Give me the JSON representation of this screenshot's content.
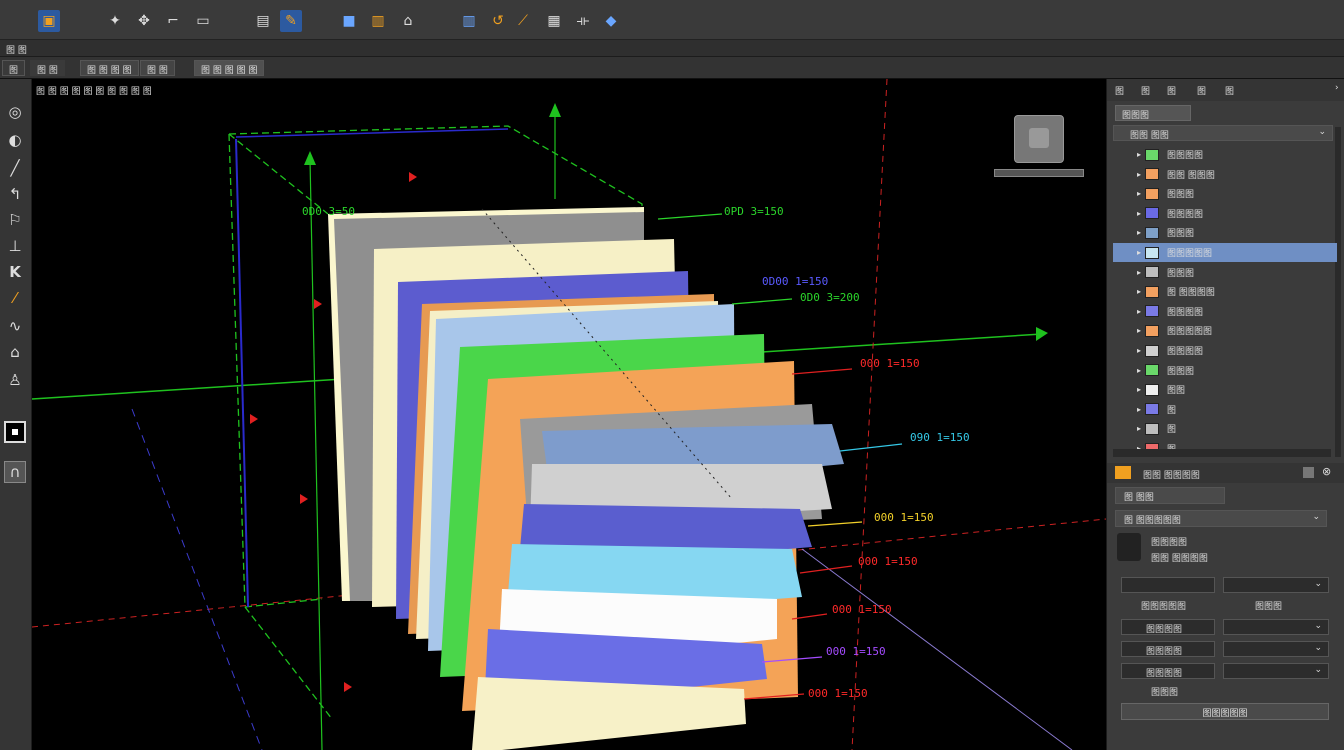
{
  "menubar": {
    "items": [
      "图 图"
    ]
  },
  "tabs": [
    "图",
    "图 图",
    "图 图 图 图",
    "图 图",
    "图 图 图 图 图"
  ],
  "viewport": {
    "labels": [
      "图 图 图 图 图 图 图 图 图 图"
    ],
    "callouts": [
      {
        "text": "0D0 3=50",
        "color": "#2bd52b"
      },
      {
        "text": "0PD 3=150",
        "color": "#2bd52b"
      },
      {
        "text": "0D00 1=150",
        "color": "#5a5aff"
      },
      {
        "text": "0D0 3=200",
        "color": "#2bd52b"
      },
      {
        "text": "000 1=150",
        "color": "#ff2a2a"
      },
      {
        "text": "090 1=150",
        "color": "#35c8e6"
      },
      {
        "text": "000 1=150",
        "color": "#f2d02a"
      },
      {
        "text": "000 1=150",
        "color": "#ff2a2a"
      },
      {
        "text": "000 1=150",
        "color": "#ff2a2a"
      },
      {
        "text": "000 1=150",
        "color": "#a44cff"
      },
      {
        "text": "000 1=150",
        "color": "#ff2a2a"
      }
    ]
  },
  "rightpanel": {
    "tabs": [
      "图",
      "图",
      "图",
      "图",
      "图"
    ],
    "search_btn": "图图图",
    "group_label": "图图 图图",
    "layers": [
      {
        "label": "图图图图",
        "color": "#6ad86a"
      },
      {
        "label": "图图 图图图",
        "color": "#f2a060"
      },
      {
        "label": "图图图",
        "color": "#f2a060"
      },
      {
        "label": "图图图图",
        "color": "#6a6ae6"
      },
      {
        "label": "图图图",
        "color": "#7ea0c8"
      },
      {
        "label": "图图图图图",
        "color": "#c8e6f2",
        "selected": true
      },
      {
        "label": "图图图",
        "color": "#bdbdbd"
      },
      {
        "label": "图 图图图图",
        "color": "#f2a060"
      },
      {
        "label": "图图图图",
        "color": "#7a7ae6"
      },
      {
        "label": "图图图图图",
        "color": "#f2a060"
      },
      {
        "label": "图图图图",
        "color": "#cfcfcf"
      },
      {
        "label": "图图图",
        "color": "#6ad86a"
      },
      {
        "label": "图图",
        "color": "#efefef"
      },
      {
        "label": "图",
        "color": "#7a7ae6"
      },
      {
        "label": "图",
        "color": "#bdbdbd"
      },
      {
        "label": "图",
        "color": "#ee6a6a"
      }
    ],
    "props": {
      "header": "图图 图图图图",
      "sub": "图 图图",
      "dropdown": "图 图图图图图",
      "line1": "图图图图",
      "line2": "图图 图图图图",
      "lbl_left": "图图图图图",
      "lbl_right": "图图图",
      "r1": "图图图图",
      "r2": "图图图图",
      "r3": "图图图图",
      "r4": "图图图",
      "bottom_btn": "图图图图图"
    }
  }
}
